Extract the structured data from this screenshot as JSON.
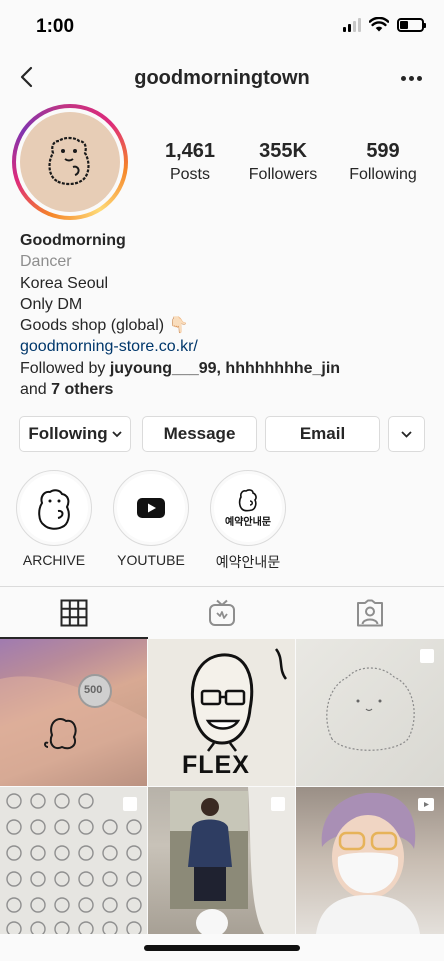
{
  "status_bar": {
    "time": "1:00"
  },
  "header": {
    "username": "goodmorningtown"
  },
  "stats": [
    {
      "value": "1,461",
      "label": "Posts"
    },
    {
      "value": "355K",
      "label": "Followers"
    },
    {
      "value": "599",
      "label": "Following"
    }
  ],
  "bio": {
    "name": "Goodmorning",
    "category": "Dancer",
    "line1": "Korea Seoul",
    "line2": "Only DM",
    "line3": "Goods shop (global) 👇🏻",
    "link": "goodmorning-store.co.kr/",
    "followed_prefix": "Followed by ",
    "followed_users": "juyoung___99, hhhhhhhhe_jin",
    "followed_and": "and ",
    "followed_others": "7 others"
  },
  "actions": {
    "following": "Following",
    "message": "Message",
    "email": "Email"
  },
  "highlights": [
    {
      "label": "ARCHIVE",
      "icon": "bear-sticker-icon"
    },
    {
      "label": "YOUTUBE",
      "icon": "youtube-icon"
    },
    {
      "label": "예약안내문",
      "icon": "bear-sticker-icon",
      "inner_text": "예약안내문"
    }
  ],
  "tabs": [
    {
      "name": "grid",
      "icon": "grid-icon",
      "active": true
    },
    {
      "name": "igtv",
      "icon": "igtv-icon",
      "active": false
    },
    {
      "name": "tagged",
      "icon": "tagged-icon",
      "active": false
    }
  ],
  "posts": [
    {
      "kind": "photo",
      "description": "tattoo-arm-coin",
      "coin_text": "500"
    },
    {
      "kind": "photo",
      "description": "flex-drawing",
      "caption_text": "FLEX"
    },
    {
      "kind": "carousel",
      "description": "cat-sketch"
    },
    {
      "kind": "carousel",
      "description": "sticker-sheet"
    },
    {
      "kind": "carousel",
      "description": "photo-of-boy"
    },
    {
      "kind": "video",
      "description": "selfie-mask"
    }
  ],
  "colors": {
    "link": "#00376b",
    "muted": "#8e8e8e",
    "border": "#dbdbdb",
    "text": "#262626"
  }
}
